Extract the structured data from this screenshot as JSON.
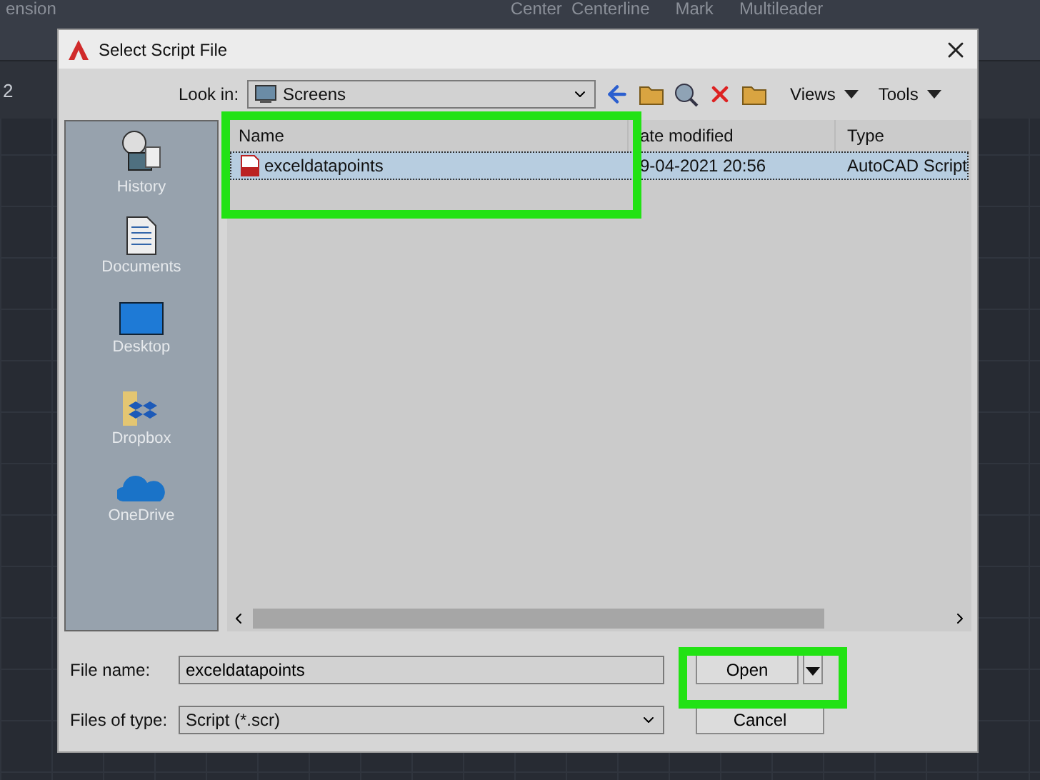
{
  "ribbon": {
    "labels": [
      "ension",
      "Center  Centerline",
      "Mark",
      "Multileader"
    ],
    "side_number": "2"
  },
  "dialog": {
    "title": "Select Script File",
    "look_in": {
      "label": "Look in:",
      "value": "Screens"
    },
    "toolbar": {
      "views": "Views",
      "tools": "Tools"
    },
    "places": [
      {
        "kind": "history",
        "label": "History"
      },
      {
        "kind": "documents",
        "label": "Documents"
      },
      {
        "kind": "desktop",
        "label": "Desktop"
      },
      {
        "kind": "dropbox",
        "label": "Dropbox"
      },
      {
        "kind": "onedrive",
        "label": "OneDrive"
      }
    ],
    "columns": [
      "Name",
      "ate modified",
      "Type"
    ],
    "rows": [
      {
        "name": "exceldatapoints",
        "date": "9-04-2021 20:56",
        "type": "AutoCAD Script",
        "selected": true,
        "highlighted": true
      }
    ],
    "file_name": {
      "label": "File name:",
      "value": "exceldatapoints"
    },
    "file_type": {
      "label": "Files of type:",
      "value": "Script (*.scr)"
    },
    "open": {
      "label": "Open",
      "highlighted": true
    },
    "cancel": {
      "label": "Cancel"
    }
  }
}
